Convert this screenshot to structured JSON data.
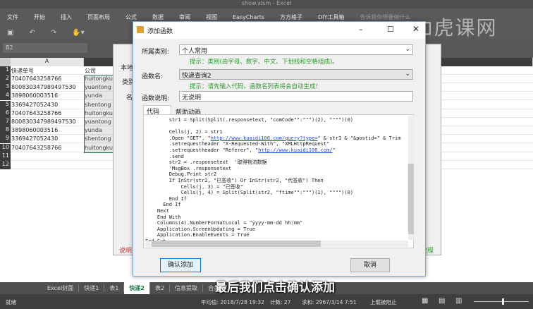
{
  "window": {
    "title": "show.xlsm - Excel"
  },
  "ribbon": {
    "tabs": [
      "文件",
      "开始",
      "插入",
      "页面布局",
      "公式",
      "数据",
      "审阅",
      "视图",
      "EasyCharts",
      "方方格子",
      "DIY工具箱"
    ],
    "search": "告诉我你想要做什么"
  },
  "namebox": "B2",
  "columns": [
    "A"
  ],
  "header_row": {
    "n": "1",
    "a": "快递单号",
    "b": "公司"
  },
  "rows": [
    {
      "n": "2",
      "a": "70407643258766",
      "b": "huitongkuaidi"
    },
    {
      "n": "3",
      "a": "800830347989497530",
      "b": "yuantong"
    },
    {
      "n": "4",
      "a": "3898060003516",
      "b": "yunda"
    },
    {
      "n": "5",
      "a": "3369427052430",
      "b": "shentong"
    },
    {
      "n": "6",
      "a": "70407643258766",
      "b": "huitongkuaidi"
    },
    {
      "n": "7",
      "a": "800830347989497530",
      "b": "yuantong"
    },
    {
      "n": "8",
      "a": "3898060003516",
      "b": "yunda"
    },
    {
      "n": "9",
      "a": "3369427052430",
      "b": "shentong"
    },
    {
      "n": "10",
      "a": "70407643258766",
      "b": "huitongkuaidi"
    },
    {
      "n": "11",
      "a": "",
      "b": ""
    },
    {
      "n": "12",
      "a": "",
      "b": ""
    }
  ],
  "bg_dialog": {
    "tab": "本地",
    "label": "类别",
    "col": "名",
    "note": "说明",
    "right": "教程"
  },
  "dialog": {
    "title": "添加函数",
    "category_label": "所属类别:",
    "category_value": "个人常用",
    "category_hint": "提示：类别(由字母、数字、中文、下划线和空格组成)。",
    "name_label": "函数名:",
    "name_value": "快递查询2",
    "name_hint": "提示：请先输入代码。函数名列表将会自动生成！",
    "desc_label": "函数说明:",
    "desc_value": "无说明",
    "tabs": [
      "代码",
      "帮助动画"
    ],
    "code": [
      [
        {
          "t": "        str1 = Split(Split(.responsetext, \"comCode\"\":\"\"\")(2), \"\"\"\")(0)"
        }
      ],
      [
        {
          "t": ""
        }
      ],
      [
        {
          "t": "        Cells(j, 2) = str1"
        }
      ],
      [
        {
          "t": "        .Open \"GET\", \""
        },
        {
          "t": "http://www.kuaidi100.com/query?type=",
          "link": true
        },
        {
          "t": "\" & str1 & \"&postid=\" & Trim"
        }
      ],
      [
        {
          "t": "        .setrequestheader \"X-Requested-With\", \"XMLHttpRequest\""
        }
      ],
      [
        {
          "t": "        .setrequestheader \"Referer\", \""
        },
        {
          "t": "http://www.kuaidi100.com/",
          "link": true
        },
        {
          "t": "\""
        }
      ],
      [
        {
          "t": "        .send"
        }
      ],
      [
        {
          "t": "        str2 = .responsetext  '取得物流数据"
        }
      ],
      [
        {
          "t": "        'MsgBox .responsetext"
        }
      ],
      [
        {
          "t": "        Debug.Print str2"
        }
      ],
      [
        {
          "t": "        If InStr(str2, \"已签收\") Or InStr(str2, \"代签收\") Then"
        }
      ],
      [
        {
          "t": "            Cells(j, 3) = \"已签收\""
        }
      ],
      [
        {
          "t": "            Cells(j, 4) = Split(Split(str2, \"ftime\"\":\"\"\")(1), \"\"\"\")(0)"
        }
      ],
      [
        {
          "t": "        End If"
        }
      ],
      [
        {
          "t": "      End If"
        }
      ],
      [
        {
          "t": "    Next"
        }
      ],
      [
        {
          "t": "    End With"
        }
      ],
      [
        {
          "t": "    Columns(4).NumberFormatLocal = \"yyyy-mm-dd hh:mm\""
        }
      ],
      [
        {
          "t": "    Application.ScreenUpdating = True"
        }
      ],
      [
        {
          "t": "    Application.EnableEvents = True"
        }
      ],
      [
        {
          "t": "End Sub"
        }
      ]
    ],
    "confirm": "确认添加",
    "cancel": "取消"
  },
  "sheets": [
    "Excel封面",
    "快递1",
    "表1",
    "快递2",
    "表2",
    "信息提取",
    "合并"
  ],
  "active_sheet": "快递2",
  "status": {
    "ready": "就绪",
    "average": "平均值: 2018/7/28 19:32",
    "count": "计数: 27",
    "sum": "求和: 2967/3/14 7:51",
    "upload": "上载被阻止"
  },
  "subtitle": "最后我们点击确认添加",
  "watermark": "虎课网"
}
